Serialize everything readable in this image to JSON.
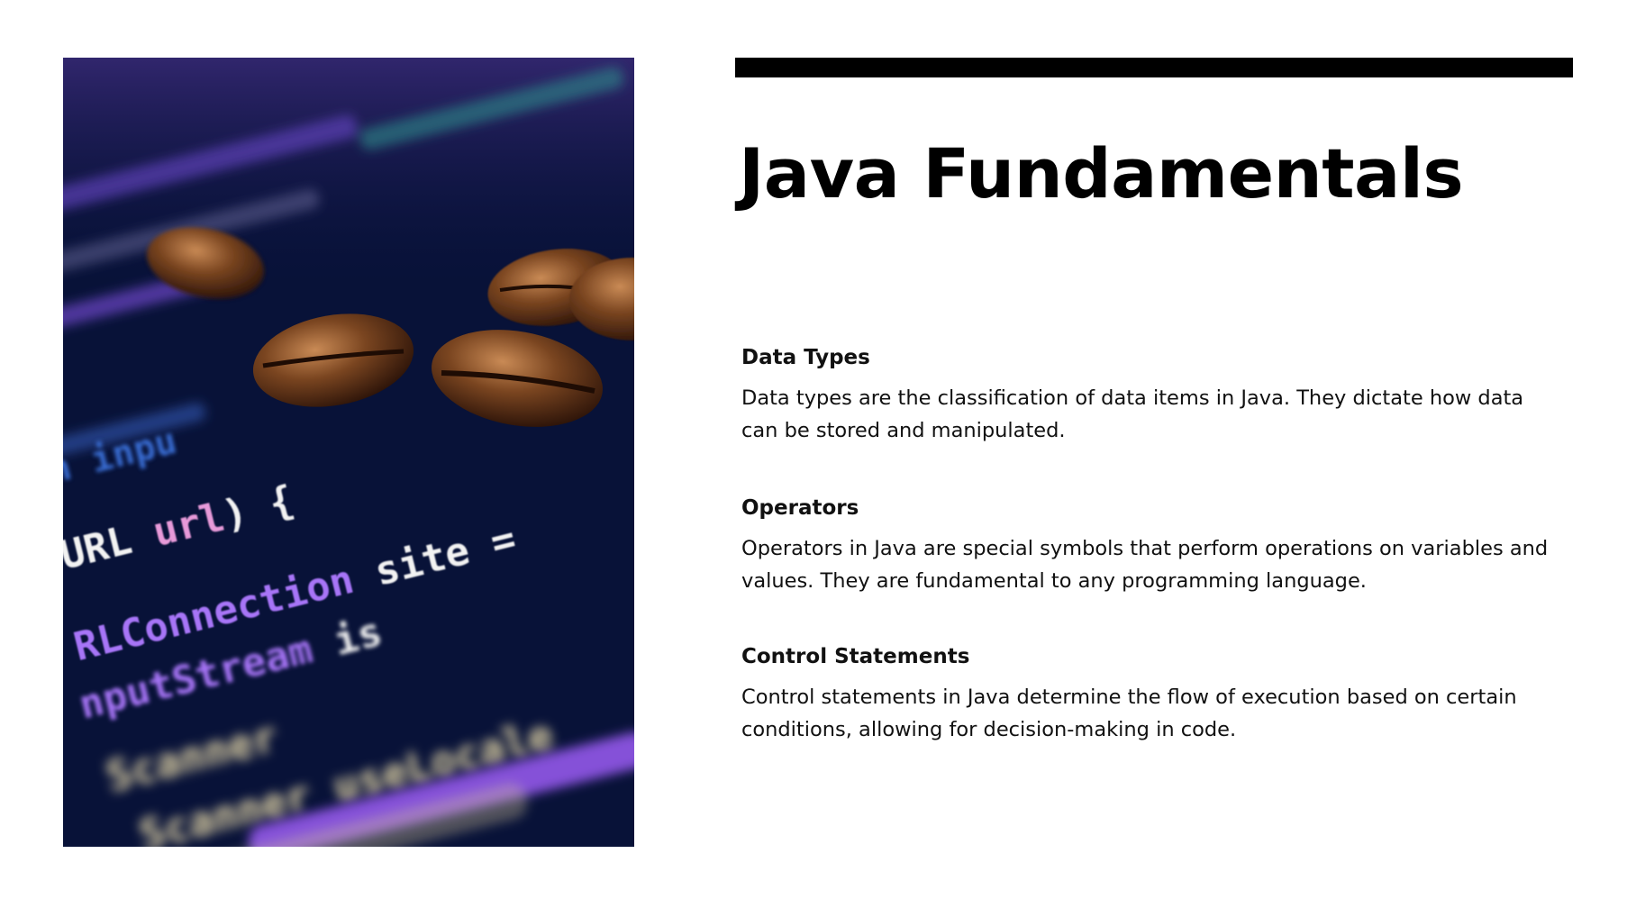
{
  "slide": {
    "title": "Java Fundamentals",
    "image": {
      "description_icon": "code-photo-with-coffee-beans",
      "code_lines": [
        "n inpu",
        "URL url) {",
        "RLConnection site =",
        "nputStream is",
        "Scanner",
        "Scanner useLocale"
      ]
    },
    "sections": [
      {
        "heading": "Data Types",
        "body": "Data types are the classification of data items in Java. They dictate how data can be stored and manipulated."
      },
      {
        "heading": "Operators",
        "body": "Operators in Java are special symbols that perform operations on variables and values. They are fundamental to any programming language."
      },
      {
        "heading": "Control Statements",
        "body": "Control statements in Java determine the flow of execution based on certain conditions, allowing for decision-making in code."
      }
    ]
  },
  "colors": {
    "accent_bar": "#000000",
    "text": "#111111",
    "photo_background": "#071033",
    "code_pink": "#e79ad9",
    "code_white": "#f2f2f2",
    "code_purple": "#9b5cf5"
  }
}
